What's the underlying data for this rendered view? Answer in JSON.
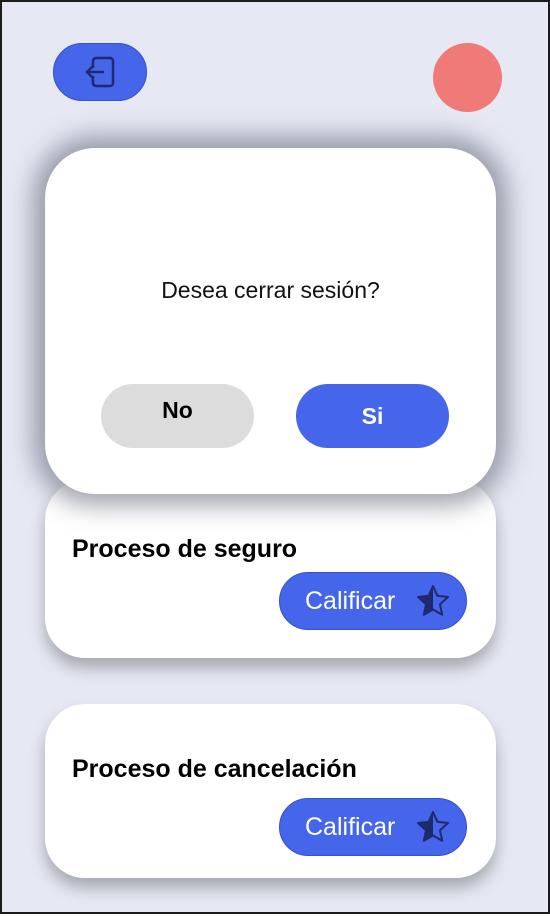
{
  "header": {
    "logout_icon": "logout-icon",
    "avatar_color": "#f07a78"
  },
  "colors": {
    "accent": "#4565ea",
    "background": "#e6e8f3",
    "neutral_button": "#dcdcdc"
  },
  "dialog": {
    "message": "Desea cerrar sesión?",
    "no_label": "No",
    "yes_label": "Si"
  },
  "processes": [
    {
      "title": "Proceso de seguro",
      "action_label": "Calificar",
      "action_icon": "star-icon"
    },
    {
      "title": "Proceso de cancelación",
      "action_label": "Calificar",
      "action_icon": "star-icon"
    }
  ]
}
